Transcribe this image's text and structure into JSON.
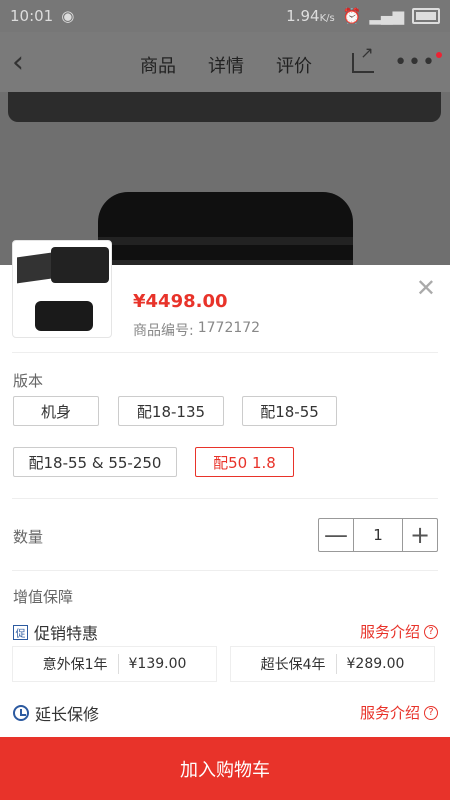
{
  "status": {
    "time": "10:01",
    "network_speed": "1.94",
    "network_unit": "K/s"
  },
  "nav": {
    "tabs": [
      "商品",
      "详情",
      "评价"
    ]
  },
  "product": {
    "price": "¥4498.00",
    "code_label": "商品编号:",
    "code": "1772172"
  },
  "version": {
    "title": "版本",
    "options": [
      "机身",
      "配18-135",
      "配18-55",
      "配18-55 & 55-250",
      "配50 1.8"
    ],
    "selected_index": 4
  },
  "quantity": {
    "title": "数量",
    "value": "1",
    "minus": "—",
    "plus": "+"
  },
  "value_added": {
    "title": "增值保障",
    "promo": {
      "label": "促销特惠",
      "icon_text": "促",
      "link": "服务介绍",
      "items": [
        {
          "name": "意外保1年",
          "price": "¥139.00"
        },
        {
          "name": "超长保4年",
          "price": "¥289.00"
        }
      ]
    },
    "extended": {
      "label": "延长保修",
      "link": "服务介绍"
    }
  },
  "cart_button": "加入购物车",
  "colors": {
    "accent": "#e8332a",
    "icon_blue": "#2c5aa0"
  },
  "icons": {
    "back": "chevron-left-icon",
    "share": "share-icon",
    "more": "more-icon",
    "close": "close-icon"
  }
}
